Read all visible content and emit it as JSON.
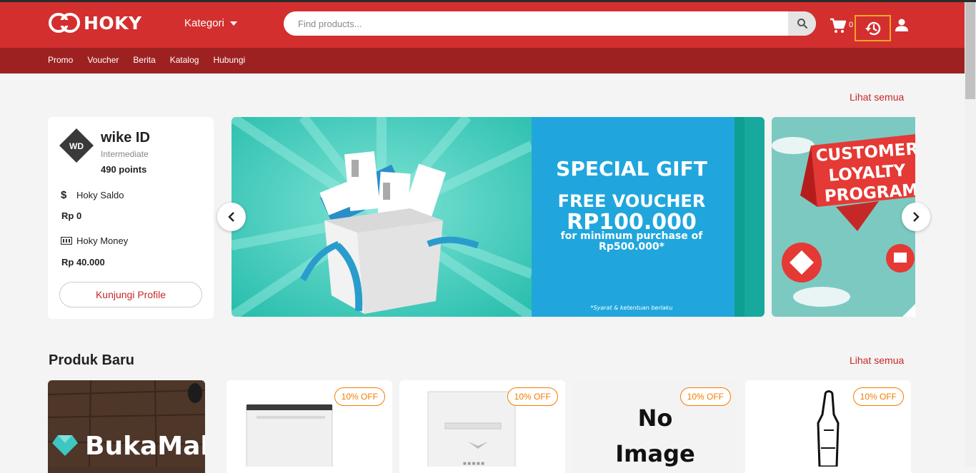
{
  "header": {
    "logo_text": "HOKY",
    "kategori_label": "Kategori",
    "search_placeholder": "Find products...",
    "cart_count": "0"
  },
  "subnav": [
    "Promo",
    "Voucher",
    "Berita",
    "Katalog",
    "Hubungi"
  ],
  "banner_section": {
    "see_all": "Lihat semua"
  },
  "profile": {
    "name": "wike ID",
    "level": "Intermediate",
    "points": "490 points",
    "saldo_label": "Hoky Saldo",
    "saldo_value": "Rp 0",
    "money_label": "Hoky Money",
    "money_value": "Rp 40.000",
    "visit_button": "Kunjungi Profile"
  },
  "banner1": {
    "title": "SPECIAL GIFT",
    "line1": "FREE VOUCHER",
    "amount": "RP100.000",
    "line3": "for minimum purchase of",
    "line4": "Rp500.000*",
    "footnote": "*Syarat & ketentuan berlaku"
  },
  "banner2": {
    "line1": "CUSTOMER",
    "line2": "LOYALTY",
    "line3": "PROGRAM"
  },
  "products": {
    "title": "Produk Baru",
    "see_all": "Lihat semua",
    "first_card_text": "BukaMall",
    "badge": "10% OFF",
    "no_image_line1": "No",
    "no_image_line2": "Image"
  },
  "colors": {
    "brand_red": "#d32f2f",
    "dark_red": "#9e2121",
    "badge_orange": "#f57c00",
    "highlight": "#f5a623"
  }
}
